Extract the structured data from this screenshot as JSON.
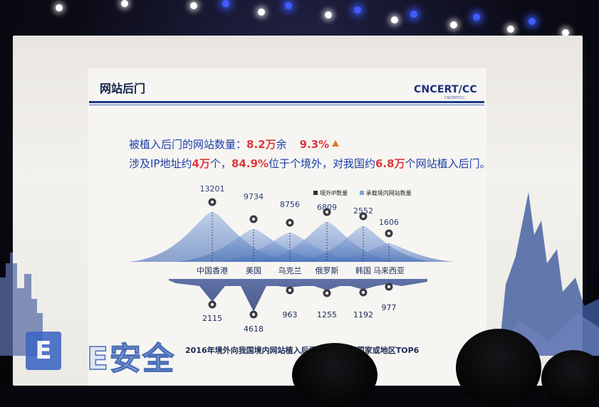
{
  "slide": {
    "title": "网站后门",
    "brand": "CNCERT/CC",
    "brand_sub": "CNCERT/CC",
    "line1": {
      "prefix": "被植入后门的网站数量：",
      "count": "8.2万",
      "suffix": "余",
      "percent": "9.3%"
    },
    "line2": {
      "p1": "涉及IP地址约",
      "ip_count": "4万",
      "p2": "个，",
      "overseas_pct": "84.9%",
      "p3": "位于个境外，对我国约",
      "site_count": "6.8万",
      "p4": "个网站植入后门。"
    },
    "caption": "2016年境外向我国境内网站植入后门IP地址所属国家或地区TOP6"
  },
  "watermark": {
    "badge": "E",
    "text": "E安全"
  },
  "colors": {
    "accent_red": "#e0383b",
    "text_blue": "#1c3ea8",
    "header_blue": "#1b3a8a",
    "series_ip": "#333333",
    "series_sites": "#7fa3d6",
    "mountain_dark": "#4a5f9c"
  },
  "chart_data": {
    "type": "area",
    "legend": [
      "境外IP数量",
      "承载境内网站数量"
    ],
    "categories": [
      "中国香港",
      "美国",
      "乌克兰",
      "俄罗斯",
      "韩国",
      "马来西亚"
    ],
    "series": [
      {
        "name": "承载境内网站数量",
        "values": [
          13201,
          9734,
          8756,
          6809,
          2552,
          1606
        ]
      },
      {
        "name": "境外IP数量",
        "values": [
          2115,
          4618,
          963,
          1255,
          1192,
          977
        ]
      }
    ],
    "legend_position": "top-right",
    "grid": false
  }
}
